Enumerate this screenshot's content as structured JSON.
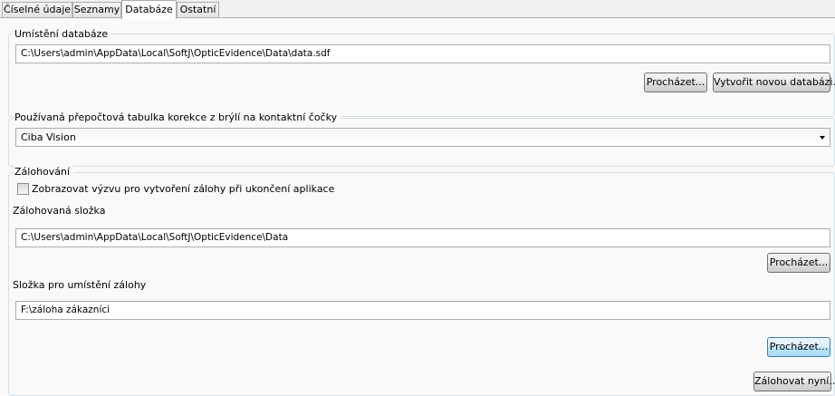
{
  "tabs": [
    {
      "label": "Číselné údaje",
      "active": false
    },
    {
      "label": "Seznamy",
      "active": false
    },
    {
      "label": "Databáze",
      "active": true
    },
    {
      "label": "Ostatní",
      "active": false
    }
  ],
  "database_location": {
    "legend": "Umístění databáze",
    "path": "C:\\Users\\admin\\AppData\\Local\\SoftJ\\OpticEvidence\\Data\\data.sdf",
    "browse_label": "Procházet...",
    "create_label": "Vytvořit novou databázi..."
  },
  "conversion_table": {
    "legend": "Používaná přepočtová tabulka korekce z brýlí na kontaktní čočky",
    "selected": "Ciba Vision"
  },
  "backup": {
    "legend": "Zálohování",
    "prompt_checkbox_label": "Zobrazovat výzvu pro vytvoření zálohy při ukončení aplikace",
    "prompt_checked": false,
    "source_label": "Zálohovaná složka",
    "source_path": "C:\\Users\\admin\\AppData\\Local\\SoftJ\\OpticEvidence\\Data",
    "source_browse_label": "Procházet...",
    "target_label": "Složka pro umístění zálohy",
    "target_path": "F:\\záloha zákazníci",
    "target_browse_label": "Procházet...",
    "backup_now_label": "Zálohovat nyní..."
  }
}
